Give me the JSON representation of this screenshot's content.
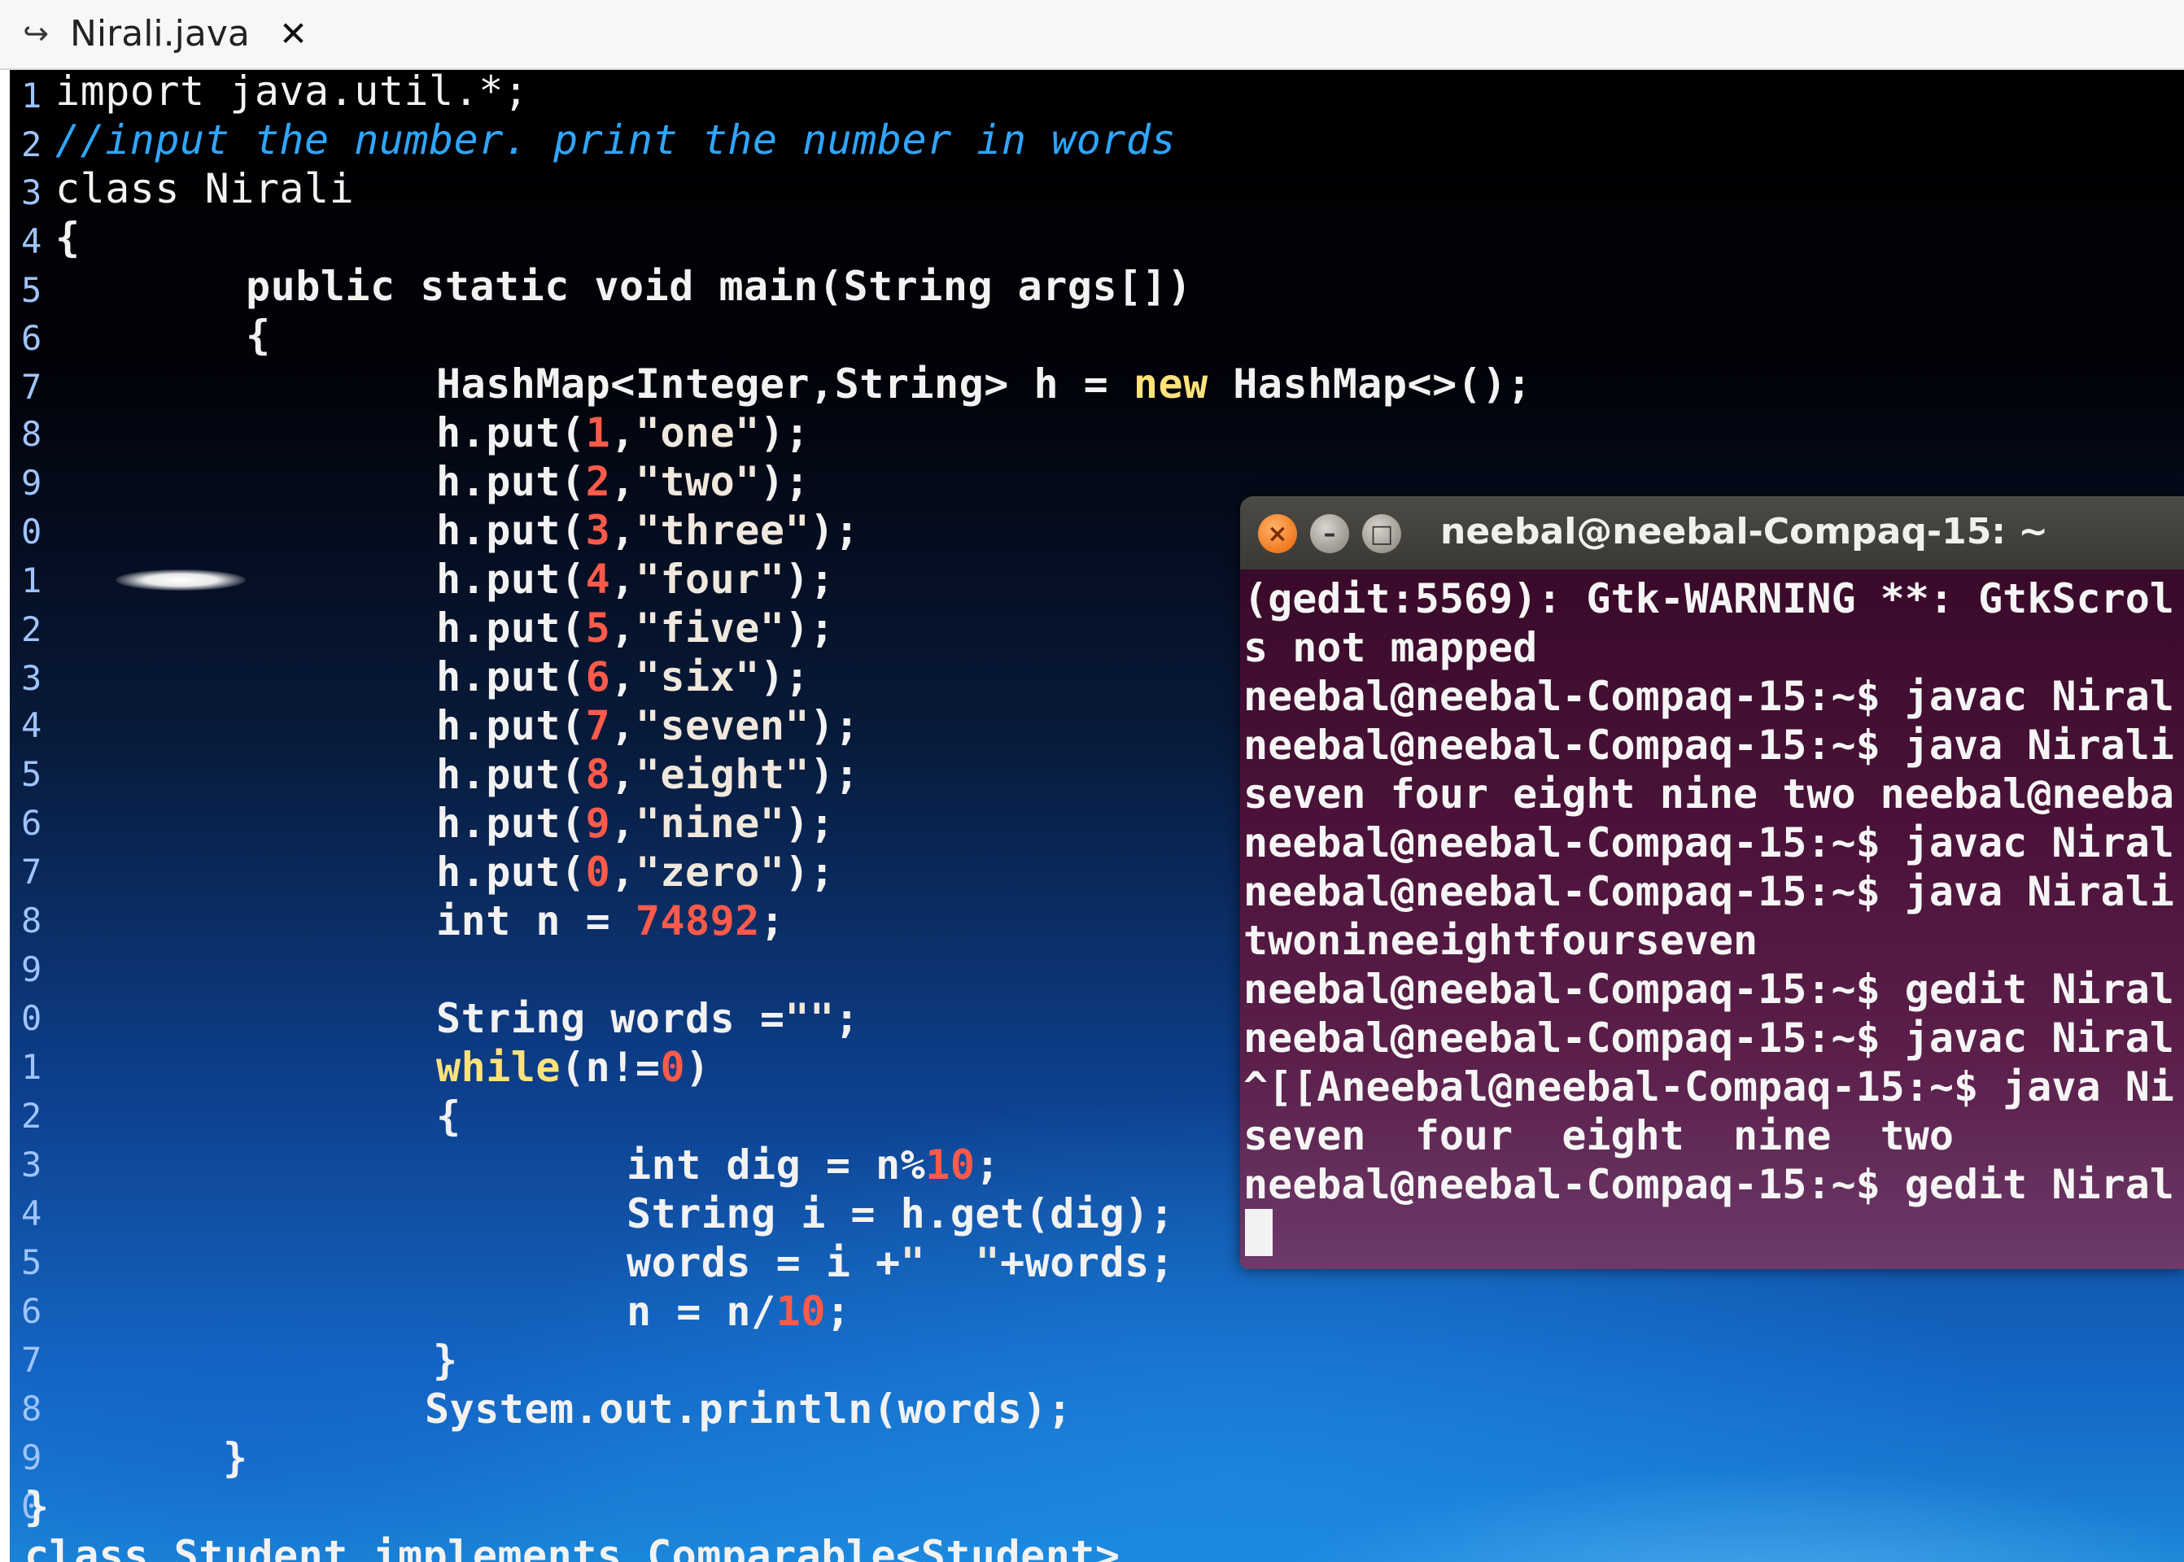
{
  "tab": {
    "icon": "file-icon",
    "title": "Nirali.java",
    "close_glyph": "✕"
  },
  "editor": {
    "line_numbers": [
      "1",
      "2",
      "3",
      "4",
      "5",
      "6",
      "7",
      "8",
      "9",
      "0",
      "1",
      "2",
      "3",
      "4",
      "5",
      "6",
      "7",
      "8",
      "9",
      "0",
      "1",
      "2",
      "3",
      "4",
      "5",
      "6",
      "7",
      "8",
      "9",
      "0"
    ],
    "lines": [
      "import java.util.*;",
      "//input the number. print the number in words",
      "class Nirali",
      "{",
      "public static void main(String args[])",
      "{",
      "HashMap<Integer,String> h = new HashMap<>();",
      "h.put(1,\"one\");",
      "h.put(2,\"two\");",
      "h.put(3,\"three\");",
      "h.put(4,\"four\");",
      "h.put(5,\"five\");",
      "h.put(6,\"six\");",
      "h.put(7,\"seven\");",
      "h.put(8,\"eight\");",
      "h.put(9,\"nine\");",
      "h.put(0,\"zero\");",
      "int n = 74892;",
      "",
      "String words =\"\";",
      "while(n!=0)",
      "{",
      "int dig = n%10;",
      "String i = h.get(dig);",
      "words = i +\"  \"+words;",
      "n = n/10;",
      "}",
      "System.out.println(words);",
      "}",
      "}",
      "class Student implements Comparable<Student>"
    ]
  },
  "terminal": {
    "title": "neebal@neebal-Compaq-15: ~",
    "buttons": {
      "close": "×",
      "minimize": "–",
      "maximize": "□"
    },
    "lines": [
      "(gedit:5569): Gtk-WARNING **: GtkScrol",
      "s not mapped",
      "neebal@neebal-Compaq-15:~$ javac Niral",
      "neebal@neebal-Compaq-15:~$ java Nirali",
      "seven four eight nine two neebal@neeba",
      "neebal@neebal-Compaq-15:~$ javac Niral",
      "neebal@neebal-Compaq-15:~$ java Nirali",
      "twonineeightfourseven",
      "neebal@neebal-Compaq-15:~$ gedit Niral",
      "neebal@neebal-Compaq-15:~$ javac Niral",
      "^[[Aneebal@neebal-Compaq-15:~$ java Ni",
      "seven  four  eight  nine  two",
      "neebal@neebal-Compaq-15:~$ gedit Niral"
    ]
  }
}
